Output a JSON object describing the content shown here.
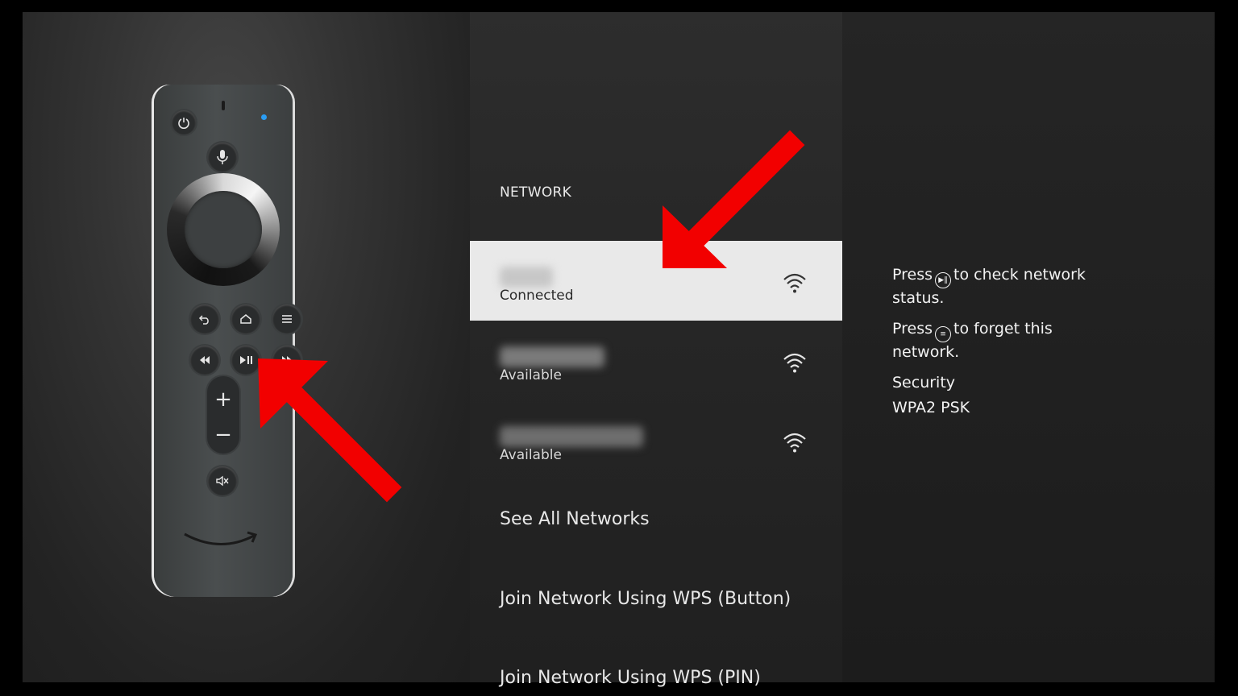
{
  "network": {
    "heading": "NETWORK",
    "networks": [
      {
        "status": "Connected",
        "selected": true
      },
      {
        "status": "Available",
        "selected": false
      },
      {
        "status": "Available",
        "selected": false
      }
    ],
    "menu": [
      "See All Networks",
      "Join Network Using WPS (Button)",
      "Join Network Using WPS (PIN)"
    ]
  },
  "info": {
    "press_word": "Press",
    "check_status": "to check network",
    "check_status_2": "status.",
    "forget": "to forget this",
    "forget_2": "network.",
    "security_label": "Security",
    "security_value": "WPA2 PSK",
    "play_pause_glyph": "play-pause-icon",
    "menu_glyph": "menu-icon"
  },
  "remote": {
    "buttons": [
      "power-icon",
      "microphone-icon",
      "back-icon",
      "home-icon",
      "menu-icon",
      "rewind-icon",
      "play-pause-icon",
      "fast-forward-icon",
      "volume-up-icon",
      "volume-down-icon",
      "mute-icon"
    ]
  },
  "colors": {
    "arrow": "#f20000",
    "selected_row": "#e9e9e9",
    "led": "#2a9df4"
  }
}
